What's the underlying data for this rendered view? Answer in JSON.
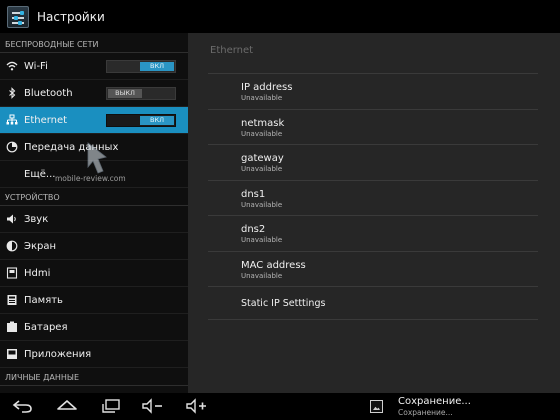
{
  "app": {
    "title": "Настройки"
  },
  "sections": {
    "wireless": "БЕСПРОВОДНЫЕ СЕТИ",
    "device": "УСТРОЙСТВО",
    "personal": "ЛИЧНЫЕ ДАННЫЕ"
  },
  "wireless_items": [
    {
      "label": "Wi-Fi",
      "icon": "wifi-icon",
      "switch": "ВКЛ"
    },
    {
      "label": "Bluetooth",
      "icon": "bluetooth-icon",
      "switch": "ВЫКЛ"
    },
    {
      "label": "Ethernet",
      "icon": "ethernet-icon",
      "switch": "ВКЛ",
      "selected": true
    },
    {
      "label": "Передача данных",
      "icon": "data-usage-icon"
    },
    {
      "label": "Ещё..."
    }
  ],
  "device_items": [
    {
      "label": "Звук",
      "icon": "sound-icon"
    },
    {
      "label": "Экран",
      "icon": "display-icon"
    },
    {
      "label": "Hdmi",
      "icon": "hdmi-icon"
    },
    {
      "label": "Память",
      "icon": "storage-icon"
    },
    {
      "label": "Батарея",
      "icon": "battery-icon"
    },
    {
      "label": "Приложения",
      "icon": "apps-icon"
    }
  ],
  "detail": {
    "header": "Ethernet",
    "prefs": [
      {
        "title": "IP address",
        "summary": "Unavailable"
      },
      {
        "title": "netmask",
        "summary": "Unavailable"
      },
      {
        "title": "gateway",
        "summary": "Unavailable"
      },
      {
        "title": "dns1",
        "summary": "Unavailable"
      },
      {
        "title": "dns2",
        "summary": "Unavailable"
      },
      {
        "title": "MAC address",
        "summary": "Unavailable"
      }
    ],
    "static_ip": "Static IP Setttings"
  },
  "notification": {
    "title": "Сохранение...",
    "subtitle": "Сохранение..."
  },
  "watermark": "mobile-review.com",
  "colors": {
    "accent": "#1a8fc0",
    "switch_on": "#2a95c4",
    "pane": "#262626"
  }
}
